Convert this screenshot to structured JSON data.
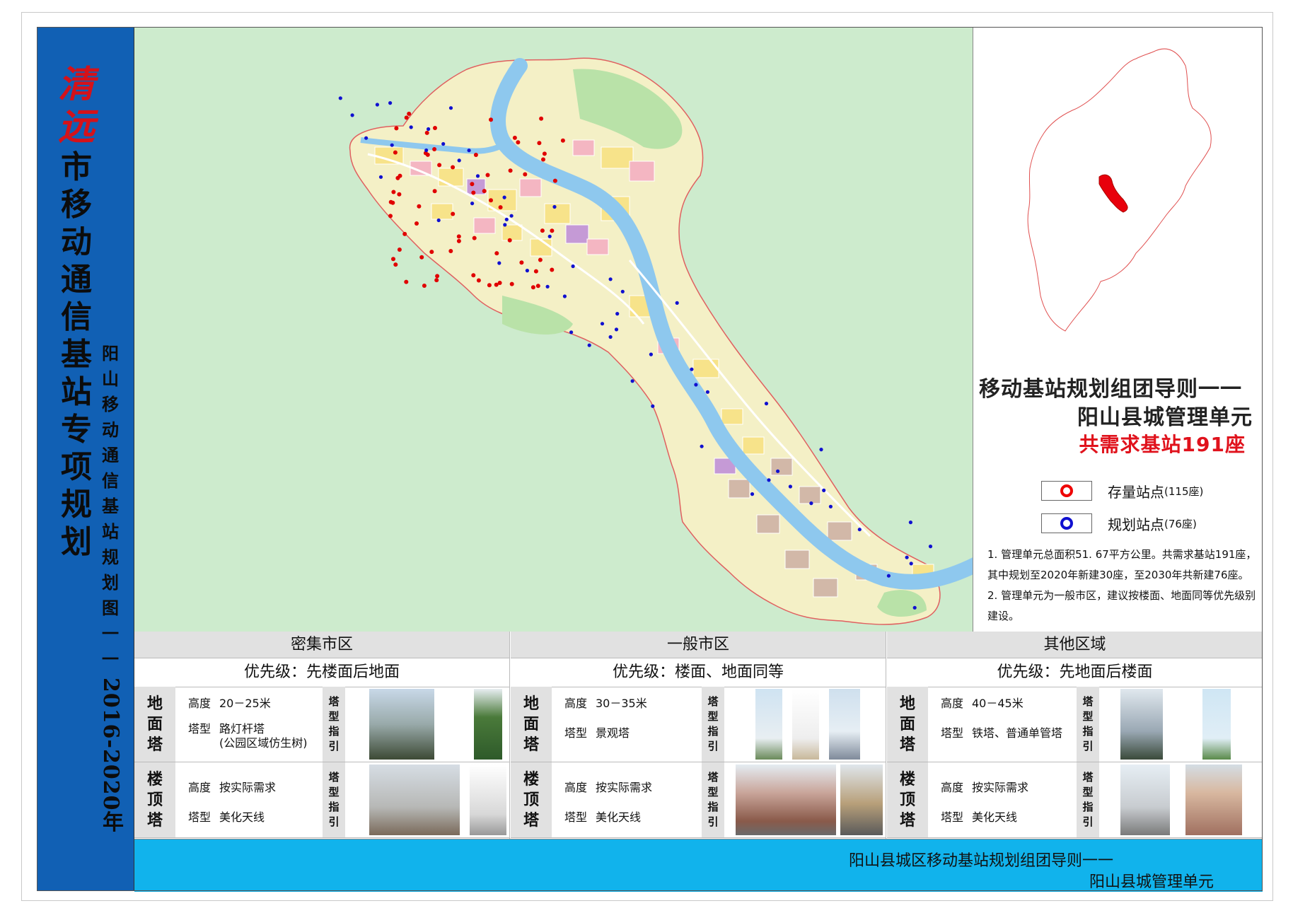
{
  "cover": {
    "title_chars": [
      "清",
      "远",
      "市",
      "移",
      "动",
      "通",
      "信",
      "基",
      "站",
      "专",
      "项",
      "规",
      "划"
    ],
    "subtitle_chars": [
      "阳",
      "山",
      "移",
      "动",
      "通",
      "信",
      "基",
      "站",
      "规",
      "划",
      "图",
      "一",
      "一"
    ],
    "years": "2016-2020年"
  },
  "panel": {
    "title_line1": "移动基站规划组团导则一一",
    "title_line2": "阳山县城管理单元",
    "demand": "共需求基站191座"
  },
  "legend": {
    "existing_label": "存量站点",
    "existing_count": "(115座)",
    "existing_color": "#e00000",
    "planned_label": "规划站点",
    "planned_count": "(76座)",
    "planned_color": "#1010d0"
  },
  "notes": [
    "1. 管理单元总面积51. 67平方公里。共需求基站191座，其中规划至2020年新建30座，至2030年共新建76座。",
    "2. 管理单元为一般市区，建议按楼面、地面同等优先级别建设。"
  ],
  "table": {
    "zones": [
      {
        "name": "密集市区",
        "priority": "优先级：先楼面后地面",
        "ground": {
          "label": [
            "地",
            "面",
            "塔"
          ],
          "height_key": "高度",
          "height": "20－25米",
          "type_key": "塔型",
          "type": "路灯杆塔",
          "type_note": "(公园区域仿生树)"
        },
        "roof": {
          "label": [
            "楼",
            "顶",
            "塔"
          ],
          "height_key": "高度",
          "height": "按实际需求",
          "type_key": "塔型",
          "type": "美化天线"
        },
        "guide": [
          "塔",
          "型",
          "指",
          "引"
        ]
      },
      {
        "name": "一般市区",
        "priority": "优先级：楼面、地面同等",
        "ground": {
          "label": [
            "地",
            "面",
            "塔"
          ],
          "height_key": "高度",
          "height": "30－35米",
          "type_key": "塔型",
          "type": "景观塔",
          "type_note": ""
        },
        "roof": {
          "label": [
            "楼",
            "顶",
            "塔"
          ],
          "height_key": "高度",
          "height": "按实际需求",
          "type_key": "塔型",
          "type": "美化天线"
        },
        "guide": [
          "塔",
          "型",
          "指",
          "引"
        ]
      },
      {
        "name": "其他区域",
        "priority": "优先级：先地面后楼面",
        "ground": {
          "label": [
            "地",
            "面",
            "塔"
          ],
          "height_key": "高度",
          "height": "40－45米",
          "type_key": "塔型",
          "type": "铁塔、普通单管塔",
          "type_note": ""
        },
        "roof": {
          "label": [
            "楼",
            "顶",
            "塔"
          ],
          "height_key": "高度",
          "height": "按实际需求",
          "type_key": "塔型",
          "type": "美化天线"
        },
        "guide": [
          "塔",
          "型",
          "指",
          "引"
        ]
      }
    ]
  },
  "footer": {
    "line1": "阳山县城区移动基站规划组团导则一一",
    "line2": "阳山县城管理单元"
  },
  "map": {
    "water_color": "#8ec8ee",
    "boundary_color": "#e06060",
    "existing_dot_color": "#e00000",
    "planned_dot_color": "#1010d0"
  }
}
